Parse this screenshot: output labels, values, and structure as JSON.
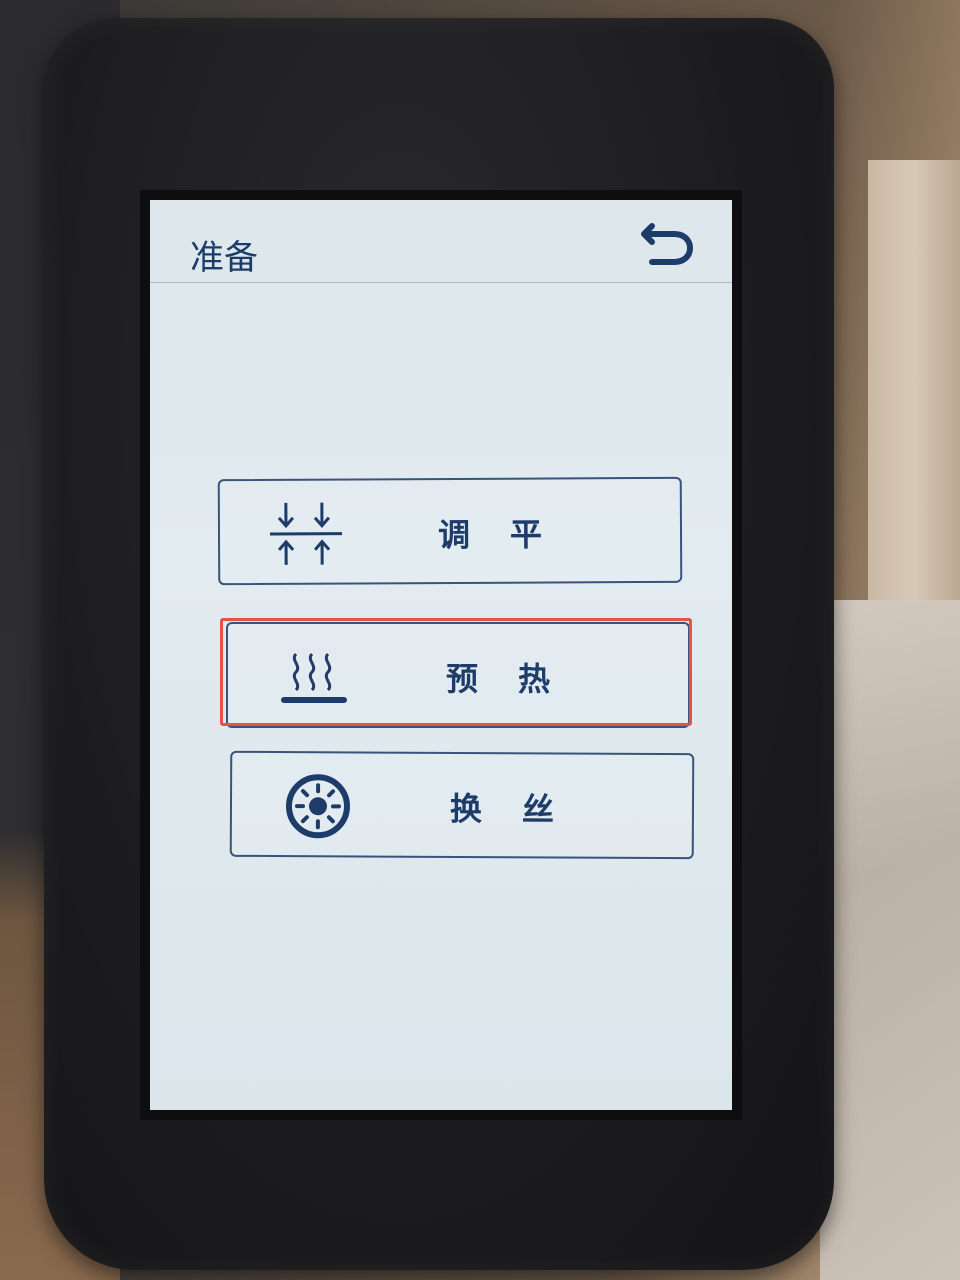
{
  "header": {
    "title": "准备"
  },
  "icons": {
    "back": "back-arrow-icon",
    "level": "level-arrows-icon",
    "preheat": "heat-waves-icon",
    "filament": "filament-spool-icon"
  },
  "menu": {
    "items": [
      {
        "label": "调平",
        "icon": "level-arrows-icon"
      },
      {
        "label": "预热",
        "icon": "heat-waves-icon"
      },
      {
        "label": "换丝",
        "icon": "filament-spool-icon"
      }
    ]
  },
  "colors": {
    "accent": "#1d3c6a",
    "highlight": "#e8504a",
    "screen": "#dde7ec"
  }
}
